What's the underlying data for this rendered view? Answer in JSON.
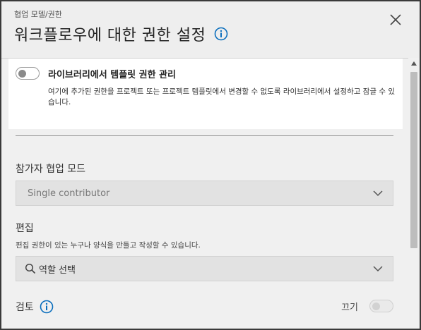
{
  "header": {
    "breadcrumb": "협업 모델/권한",
    "title": "워크플로우에 대한 권한 설정"
  },
  "library": {
    "title": "라이브러리에서 템플릿 권한 관리",
    "description": "여기에 추가된 권한을 프로젝트 또는 프로젝트 템플릿에서 변경할 수 없도록 라이브러리에서 설정하고 잠글 수 있습니다.",
    "toggle_on": false
  },
  "collab_mode": {
    "label": "참가자 협업 모드",
    "value": "Single contributor"
  },
  "edit": {
    "label": "편집",
    "description": "편집 권한이 있는 누구나 양식을 만들고 작성할 수 있습니다.",
    "placeholder": "역할 선택"
  },
  "review": {
    "label": "검토",
    "toggle_state_label": "끄기",
    "toggle_on": false
  },
  "colors": {
    "accent": "#0a6ebd",
    "dialog_bg": "#eeeeee",
    "panel_bg": "#ffffff"
  },
  "icons": {
    "close": "close-icon",
    "info": "info-icon",
    "search": "search-icon",
    "chevron": "chevron-down-icon"
  }
}
